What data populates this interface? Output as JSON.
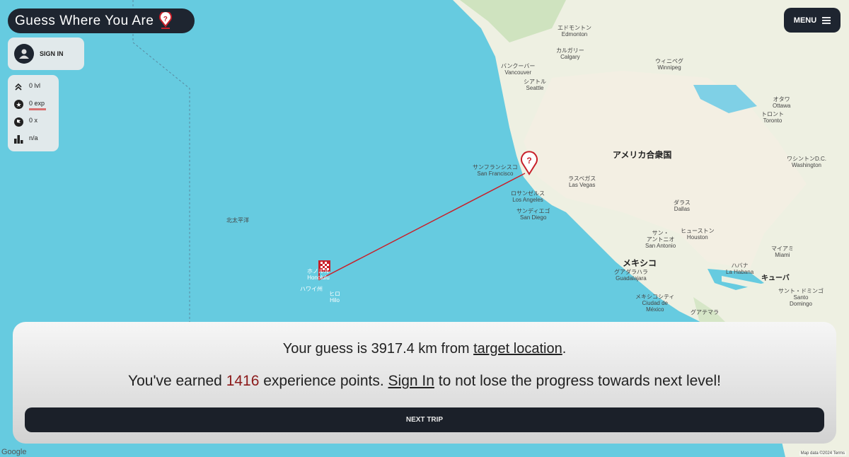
{
  "header": {
    "title": "Guess Where You Are",
    "menu_label": "MENU"
  },
  "auth": {
    "sign_in_label": "SIGN IN"
  },
  "stats": {
    "level": "0 lvl",
    "exp": "0 exp",
    "exp_progress": 0,
    "trips": "0 x",
    "rank": "n/a"
  },
  "result": {
    "line1_prefix": "Your guess is 3917.4 km from ",
    "line1_link": "target location",
    "line1_suffix": ".",
    "line2_prefix": "You've earned ",
    "xp_value": "1416",
    "line2_mid": " experience points. ",
    "line2_link": "Sign In",
    "line2_suffix": " to not lose the progress towards next level!",
    "next_label": "NEXT TRIP"
  },
  "map": {
    "labels": {
      "pacific": "北太平洋",
      "usa": "アメリカ合衆国",
      "mexico": "メキシコ",
      "sf": "サンフランシスコ\nSan Francisco",
      "la": "ロサンゼルス\nLos Angeles",
      "sd": "サンディエゴ\nSan Diego",
      "lv": "ラスベガス\nLas Vegas",
      "seattle": "シアトル\nSeattle",
      "vancouver": "バンクーバー\nVancouver",
      "calgary": "カルガリー\nCalgary",
      "edmonton": "エドモントン\nEdmonton",
      "winnipeg": "ウィニペグ\nWinnipeg",
      "dallas": "ダラス\nDallas",
      "houston": "ヒューストン\nHouston",
      "sanantonio": "サン・\nアントニオ\nSan Antonio",
      "toronto": "トロント\nToronto",
      "ottawa": "オタワ\nOttawa",
      "washington": "ワシントンD.C.\nWashington",
      "mexicocity": "メキシコシティ\nCiudad de\nMéxico",
      "guadalajara": "グアダラハラ\nGuadalajara",
      "havana": "ハバナ\nLa Habana",
      "miami": "マイアミ\nMiami",
      "cuba": "キューバ",
      "guatemala": "グアテマラ",
      "honolulu": "ホノルル\nHonolulu",
      "hawaii": "ハワイ州",
      "hilo": "ヒロ\nHilo",
      "santodomingo": "サント・ドミンゴ\nSanto\nDomingo"
    },
    "attribution": "Map data ©2024  Terms",
    "google": "Google",
    "colors": {
      "ocean": "#66cbe0",
      "land": "#eef0e2",
      "line": "#c8202a"
    }
  }
}
